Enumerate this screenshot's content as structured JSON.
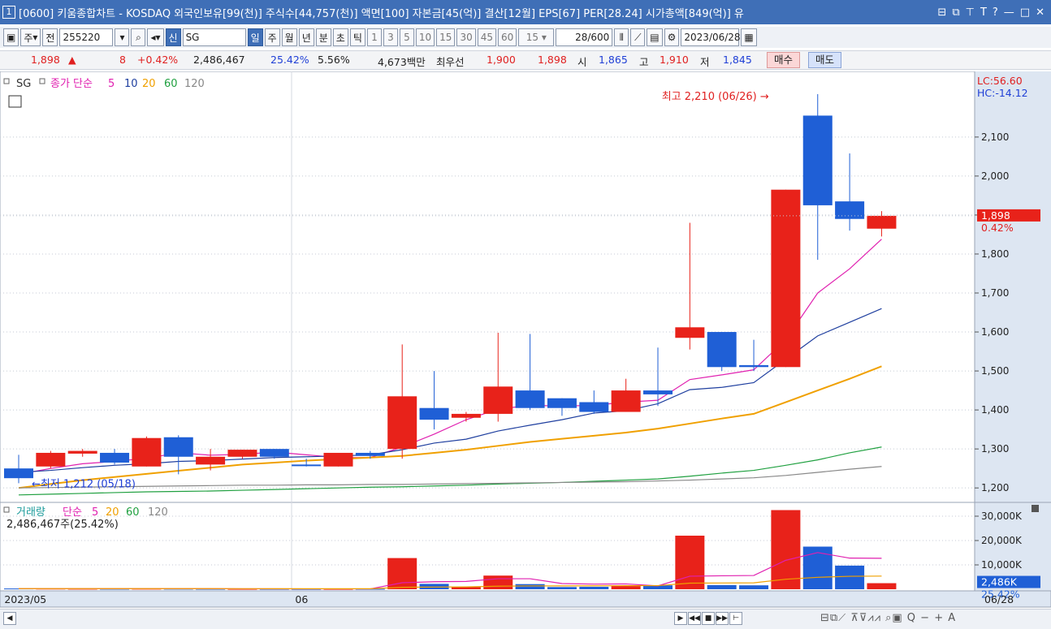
{
  "window": {
    "title": "[0600] 키움종합차트 - KOSDAQ 외국인보유[99(천)] 주식수[44,757(천)] 액면[100] 자본금[45(억)] 결산[12월] EPS[67] PER[28.24] 시가총액[849(억)] 유",
    "number_badge": "1"
  },
  "toolbar": {
    "period_select": "주",
    "prev_label": "전",
    "code_value": "255220",
    "new_badge": "신",
    "stock_name": "SG",
    "period_tabs": [
      "일",
      "주",
      "월",
      "년",
      "분",
      "초",
      "틱"
    ],
    "active_tab": "일",
    "interval_buttons": [
      "1",
      "3",
      "5",
      "10",
      "15",
      "30",
      "45",
      "60"
    ],
    "interval_select": "15",
    "count_value": "28",
    "count_total": "/600",
    "date_value": "2023/06/28"
  },
  "info": {
    "price": "1,898",
    "arrow": "▲",
    "change": "8",
    "change_pct": "+0.42%",
    "volume": "2,486,467",
    "volume_ratio": "25.42%",
    "turnover": "5.56%",
    "amount": "4,673백만",
    "bid_label": "최우선",
    "best_ask": "1,900",
    "best_bid": "1,898",
    "open_label": "시",
    "open": "1,865",
    "high_label": "고",
    "high": "1,910",
    "low_label": "저",
    "low": "1,845",
    "buy_label": "매수",
    "sell_label": "매도"
  },
  "colors": {
    "up": "#e8221a",
    "down": "#1f5fd6",
    "ma5": "#e020b0",
    "ma10": "#1f3f9f",
    "ma20": "#f0a000",
    "ma60": "#20a040",
    "ma120": "#888888",
    "axis_bg": "#dde6f2"
  },
  "chart_data": [
    {
      "type": "candlestick",
      "legend": {
        "name": "SG",
        "indicator": "종가 단순",
        "periods": [
          "5",
          "10",
          "20",
          "60",
          "120"
        ]
      },
      "ylim": [
        1165,
        2260
      ],
      "yticks": [
        "2,100",
        "2,000",
        "1,900",
        "1,800",
        "1,700",
        "1,600",
        "1,500",
        "1,400",
        "1,300",
        "1,200"
      ],
      "xlabels": [
        {
          "label": "2023/05",
          "i": -0.5
        },
        {
          "label": "06",
          "i": 8.6
        },
        {
          "label": "06/28",
          "i": 27.5
        }
      ],
      "candles": [
        {
          "o": 1250,
          "h": 1285,
          "l": 1212,
          "c": 1225
        },
        {
          "o": 1255,
          "h": 1295,
          "l": 1250,
          "c": 1290
        },
        {
          "o": 1288,
          "h": 1300,
          "l": 1280,
          "c": 1295
        },
        {
          "o": 1290,
          "h": 1300,
          "l": 1260,
          "c": 1265
        },
        {
          "o": 1255,
          "h": 1332,
          "l": 1255,
          "c": 1328
        },
        {
          "o": 1330,
          "h": 1335,
          "l": 1235,
          "c": 1280
        },
        {
          "o": 1260,
          "h": 1300,
          "l": 1245,
          "c": 1280
        },
        {
          "o": 1280,
          "h": 1298,
          "l": 1275,
          "c": 1298
        },
        {
          "o": 1300,
          "h": 1300,
          "l": 1275,
          "c": 1280
        },
        {
          "o": 1260,
          "h": 1275,
          "l": 1255,
          "c": 1258
        },
        {
          "o": 1255,
          "h": 1290,
          "l": 1255,
          "c": 1290
        },
        {
          "o": 1290,
          "h": 1295,
          "l": 1275,
          "c": 1282
        },
        {
          "o": 1300,
          "h": 1568,
          "l": 1275,
          "c": 1435
        },
        {
          "o": 1405,
          "h": 1500,
          "l": 1350,
          "c": 1375
        },
        {
          "o": 1380,
          "h": 1395,
          "l": 1370,
          "c": 1390
        },
        {
          "o": 1390,
          "h": 1598,
          "l": 1370,
          "c": 1460
        },
        {
          "o": 1450,
          "h": 1595,
          "l": 1400,
          "c": 1405
        },
        {
          "o": 1430,
          "h": 1430,
          "l": 1385,
          "c": 1405
        },
        {
          "o": 1420,
          "h": 1450,
          "l": 1390,
          "c": 1395
        },
        {
          "o": 1395,
          "h": 1480,
          "l": 1395,
          "c": 1450
        },
        {
          "o": 1450,
          "h": 1560,
          "l": 1410,
          "c": 1440
        },
        {
          "o": 1585,
          "h": 1880,
          "l": 1555,
          "c": 1612
        },
        {
          "o": 1600,
          "h": 1600,
          "l": 1500,
          "c": 1510
        },
        {
          "o": 1515,
          "h": 1580,
          "l": 1500,
          "c": 1510
        },
        {
          "o": 1510,
          "h": 1965,
          "l": 1510,
          "c": 1965
        },
        {
          "o": 2155,
          "h": 2210,
          "l": 1785,
          "c": 1925
        },
        {
          "o": 1935,
          "h": 2058,
          "l": 1860,
          "c": 1890
        },
        {
          "o": 1865,
          "h": 1910,
          "l": 1845,
          "c": 1898
        }
      ],
      "ma": [
        {
          "period": "5",
          "start": 0,
          "values": [
            1235,
            1250,
            1262,
            1268,
            1276,
            1290,
            1284,
            1286,
            1292,
            1285,
            1278,
            1278,
            1305,
            1338,
            1375,
            1402,
            1412,
            1410,
            1412,
            1420,
            1425,
            1478,
            1490,
            1503,
            1580,
            1700,
            1762,
            1838
          ]
        },
        {
          "period": "10",
          "start": 0,
          "values": [
            1240,
            1245,
            1252,
            1258,
            1262,
            1268,
            1270,
            1274,
            1278,
            1280,
            1282,
            1285,
            1298,
            1315,
            1325,
            1346,
            1361,
            1375,
            1392,
            1398,
            1416,
            1452,
            1458,
            1470,
            1530,
            1590,
            1625,
            1660
          ]
        },
        {
          "period": "20",
          "start": 0,
          "values": [
            1200,
            1210,
            1220,
            1228,
            1236,
            1244,
            1252,
            1260,
            1265,
            1270,
            1274,
            1278,
            1282,
            1290,
            1298,
            1308,
            1318,
            1326,
            1334,
            1342,
            1352,
            1365,
            1378,
            1390,
            1420,
            1450,
            1480,
            1512
          ]
        },
        {
          "period": "60",
          "start": 0,
          "values": [
            1182,
            1184,
            1186,
            1188,
            1190,
            1191,
            1192,
            1194,
            1196,
            1198,
            1200,
            1202,
            1203,
            1205,
            1207,
            1210,
            1212,
            1214,
            1217,
            1220,
            1223,
            1230,
            1238,
            1245,
            1258,
            1272,
            1290,
            1305
          ]
        },
        {
          "period": "120",
          "start": 0,
          "values": [
            1200,
            1201,
            1202,
            1203,
            1204,
            1205,
            1206,
            1207,
            1207,
            1208,
            1208,
            1209,
            1209,
            1210,
            1211,
            1212,
            1213,
            1214,
            1215,
            1216,
            1218,
            1220,
            1223,
            1226,
            1232,
            1240,
            1248,
            1255
          ]
        }
      ],
      "annotations": {
        "high": {
          "label": "최고 2,210 (06/26)",
          "index": 25,
          "value": 2210
        },
        "low": {
          "label": "최저 1,212 (05/18)",
          "index": 0,
          "value": 1212
        }
      },
      "corner": {
        "lc": "LC:56.60",
        "hc": "HC:-14.12"
      },
      "current": {
        "value": 1898,
        "price_label": "1,898",
        "pct_label": "0.42%"
      }
    },
    {
      "type": "bar",
      "legend": {
        "name": "거래량",
        "indicator": "단순",
        "periods": [
          "5",
          "20",
          "60",
          "120"
        ]
      },
      "info": "2,486,467주(25.42%)",
      "yticks": [
        {
          "label": "30,000K",
          "value": 30000
        },
        {
          "label": "20,000K",
          "value": 20000
        },
        {
          "label": "10,000K",
          "value": 10000
        }
      ],
      "ylim": [
        0,
        33000
      ],
      "volume_k": [
        300,
        250,
        200,
        180,
        220,
        200,
        160,
        150,
        140,
        120,
        130,
        150,
        12800,
        2200,
        900,
        5600,
        2100,
        900,
        1000,
        1300,
        1600,
        22000,
        1700,
        1600,
        32500,
        17500,
        9700,
        2486
      ],
      "vol_up": [
        false,
        true,
        true,
        false,
        true,
        false,
        false,
        true,
        false,
        false,
        true,
        false,
        true,
        false,
        true,
        true,
        false,
        false,
        false,
        true,
        false,
        true,
        false,
        false,
        true,
        false,
        false,
        true
      ],
      "ma5_k": [
        220,
        220,
        220,
        220,
        230,
        220,
        200,
        180,
        170,
        150,
        140,
        140,
        2660,
        3080,
        3220,
        4320,
        4320,
        2340,
        2100,
        2180,
        1380,
        5360,
        5520,
        5640,
        11880,
        15060,
        12780,
        12700
      ],
      "ma20_k": [
        250,
        250,
        250,
        250,
        250,
        250,
        240,
        230,
        220,
        210,
        200,
        200,
        800,
        900,
        950,
        1250,
        1350,
        1380,
        1420,
        1450,
        1480,
        2500,
        2560,
        2620,
        4100,
        4900,
        5320,
        5400
      ],
      "current": {
        "value": 2486,
        "label": "2,486K",
        "pct_label": "25.42%"
      }
    }
  ],
  "bottom": {
    "tools": "⊟⧉⟋ ⊼⊽⩘⩘ ⌕▣ Q − + A"
  }
}
